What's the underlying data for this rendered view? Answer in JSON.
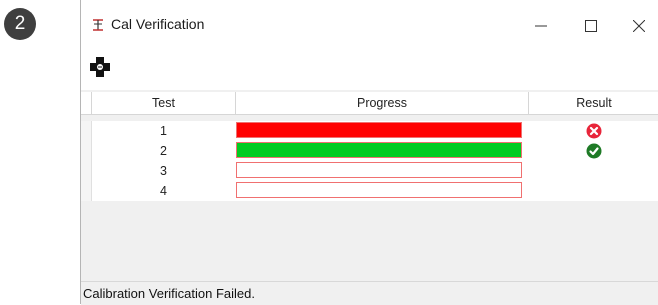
{
  "step_badge": "2",
  "window": {
    "title": "Cal Verification",
    "minimize_label": "−",
    "close_label": "×"
  },
  "grid": {
    "columns": [
      "Test",
      "Progress",
      "Result"
    ],
    "rows": [
      {
        "test": "1",
        "progress": 1.0,
        "bar_color": "#ff0000",
        "result_icon": "error-icon"
      },
      {
        "test": "2",
        "progress": 1.0,
        "bar_color": "#00cc22",
        "result_icon": "success-icon"
      },
      {
        "test": "3",
        "progress": 0.0,
        "bar_color": "#ffffff",
        "result_icon": ""
      },
      {
        "test": "4",
        "progress": 0.0,
        "bar_color": "#ffffff",
        "result_icon": ""
      }
    ]
  },
  "status": "Calibration Verification Failed.",
  "colors": {
    "error": "#e8253a",
    "success": "#1e7a26",
    "bar_border": "#f07070"
  }
}
